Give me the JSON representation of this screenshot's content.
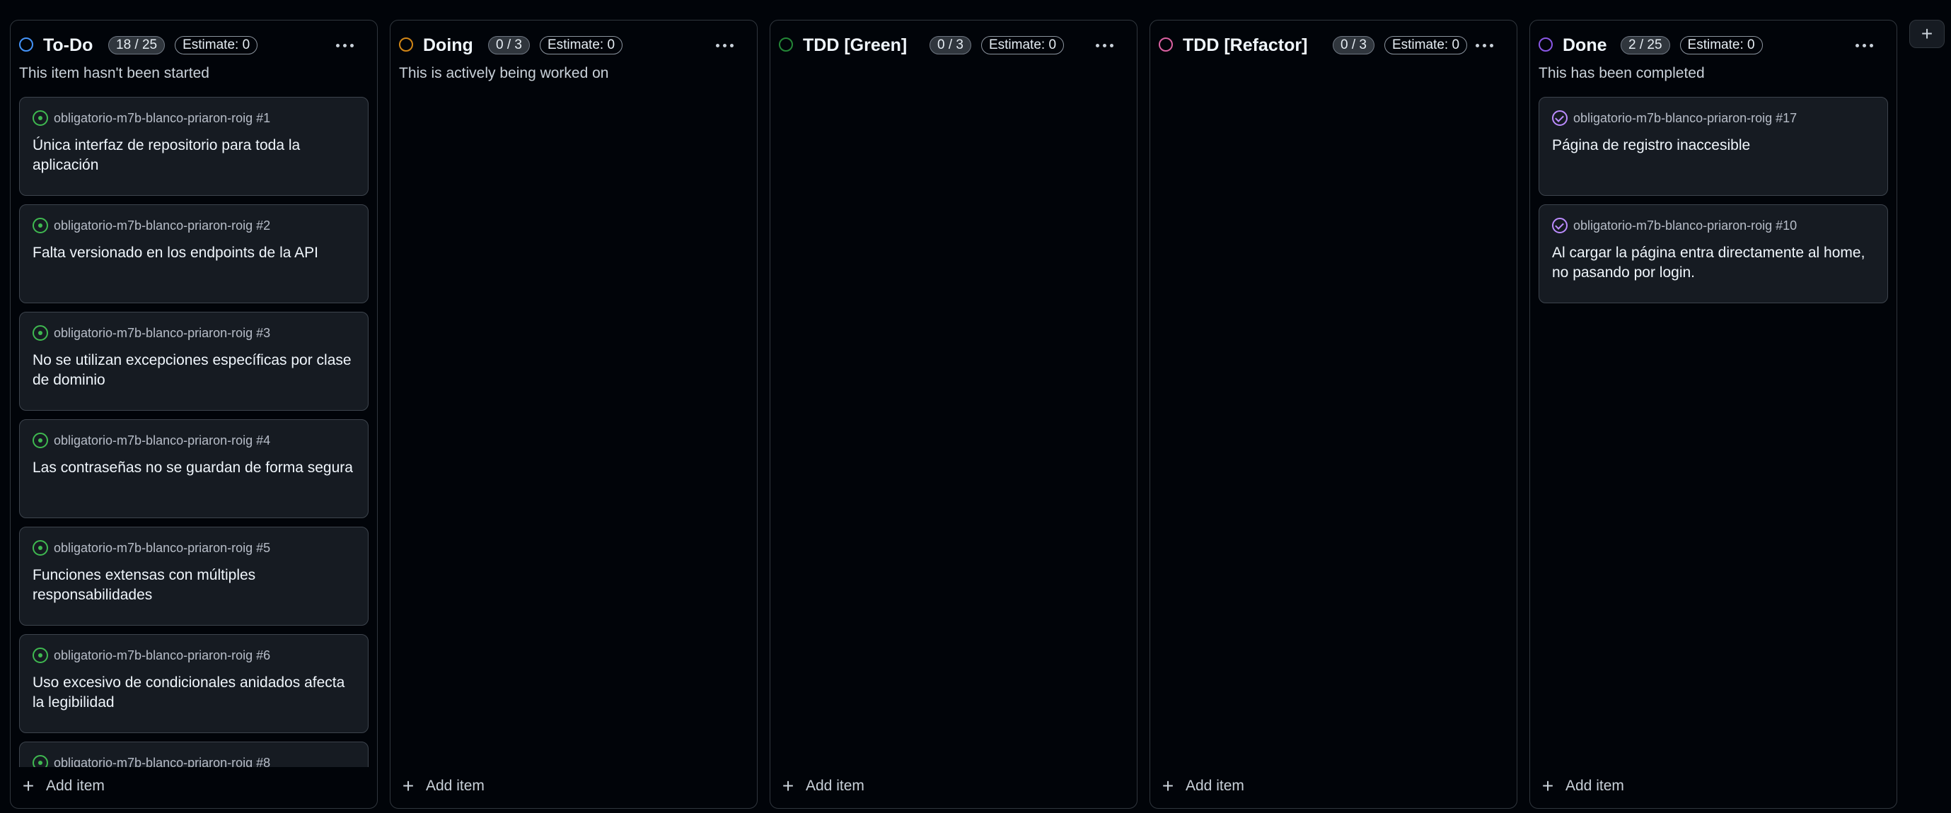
{
  "columns": [
    {
      "name": "To-Do",
      "color": "#4493f8",
      "count": "18 / 25",
      "estimate": "Estimate: 0",
      "description": "This item hasn't been started",
      "add_label": "Add item",
      "cards": [
        {
          "repo": "obligatorio-m7b-blanco-priaron-roig #1",
          "title": "Única interfaz de repositorio para toda la aplicación",
          "state": "open"
        },
        {
          "repo": "obligatorio-m7b-blanco-priaron-roig #2",
          "title": "Falta versionado en los endpoints de la API",
          "state": "open"
        },
        {
          "repo": "obligatorio-m7b-blanco-priaron-roig #3",
          "title": "No se utilizan excepciones específicas por clase de dominio",
          "state": "open"
        },
        {
          "repo": "obligatorio-m7b-blanco-priaron-roig #4",
          "title": "Las contraseñas no se guardan de forma segura",
          "state": "open"
        },
        {
          "repo": "obligatorio-m7b-blanco-priaron-roig #5",
          "title": "Funciones extensas con múltiples responsabilidades",
          "state": "open"
        },
        {
          "repo": "obligatorio-m7b-blanco-priaron-roig #6",
          "title": "Uso excesivo de condicionales anidados afecta la legibilidad",
          "state": "open"
        },
        {
          "repo": "obligatorio-m7b-blanco-priaron-roig #8",
          "title": "",
          "state": "open"
        }
      ]
    },
    {
      "name": "Doing",
      "color": "#d18616",
      "count": "0 / 3",
      "estimate": "Estimate: 0",
      "description": "This is actively being worked on",
      "add_label": "Add item",
      "cards": []
    },
    {
      "name": "TDD [Green]",
      "color": "#238636",
      "count": "0 / 3",
      "estimate": "Estimate: 0",
      "description": "",
      "add_label": "Add item",
      "cards": []
    },
    {
      "name": "TDD [Refactor]",
      "color": "#db61a2",
      "count": "0 / 3",
      "estimate": "Estimate: 0",
      "description": "",
      "add_label": "Add item",
      "cards": []
    },
    {
      "name": "Done",
      "color": "#8957e5",
      "count": "2 / 25",
      "estimate": "Estimate: 0",
      "description": "This has been completed",
      "add_label": "Add item",
      "cards": [
        {
          "repo": "obligatorio-m7b-blanco-priaron-roig #17",
          "title": "Página de registro inaccesible",
          "state": "closed"
        },
        {
          "repo": "obligatorio-m7b-blanco-priaron-roig #10",
          "title": "Al cargar la página entra directamente al home, no pasando por login.",
          "state": "closed"
        }
      ]
    }
  ],
  "add_column_icon": "plus-icon"
}
